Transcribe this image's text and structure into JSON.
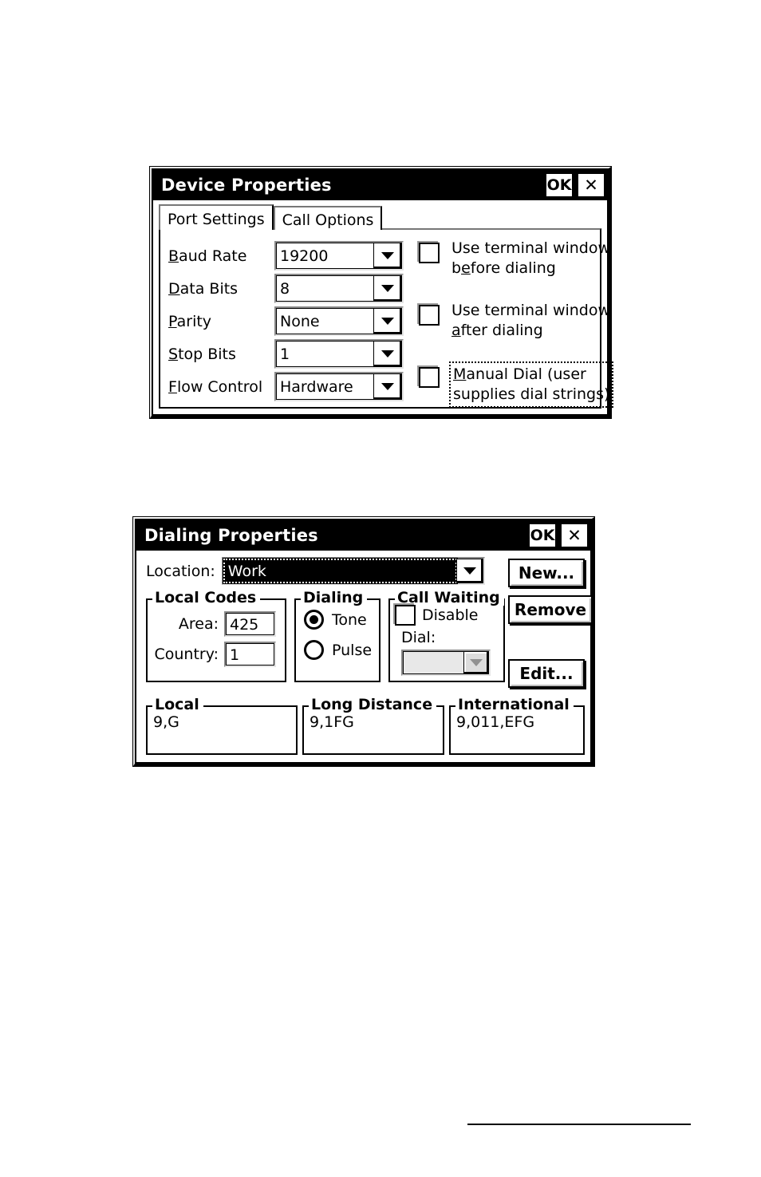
{
  "device_properties": {
    "title": "Device Properties",
    "ok_label": "OK",
    "close_label": "✕",
    "tabs": [
      {
        "label": "Port Settings",
        "active": true
      },
      {
        "label": "Call Options",
        "active": false
      }
    ],
    "fields": [
      {
        "label_pre": "",
        "accel": "B",
        "label_post": "aud Rate",
        "value": "19200"
      },
      {
        "label_pre": "",
        "accel": "D",
        "label_post": "ata Bits",
        "value": "8"
      },
      {
        "label_pre": "",
        "accel": "P",
        "label_post": "arity",
        "value": "None"
      },
      {
        "label_pre": "",
        "accel": "S",
        "label_post": "top Bits",
        "value": "1"
      },
      {
        "label_pre": "",
        "accel": "F",
        "label_post": "low Control",
        "value": "Hardware"
      }
    ],
    "checkboxes": [
      {
        "line1_pre": "Use terminal window",
        "line2_pre": "b",
        "accel": "e",
        "line2_post": "fore dialing",
        "checked": false,
        "focused": false
      },
      {
        "line1_pre": "Use terminal window",
        "line2_pre": "",
        "accel": "a",
        "line2_post": "fter dialing",
        "checked": false,
        "focused": false
      },
      {
        "line1_pre": "anual Dial (user",
        "line2_pre": "supplies dial strings)",
        "accel": "M",
        "line2_post": "",
        "checked": false,
        "focused": true
      }
    ]
  },
  "dialing_properties": {
    "title": "Dialing Properties",
    "ok_label": "OK",
    "close_label": "✕",
    "location": {
      "label": "Location:",
      "value": "Work"
    },
    "buttons": {
      "new": "New...",
      "remove": "Remove",
      "edit": "Edit..."
    },
    "local_codes": {
      "title": "Local Codes",
      "area_label": "Area:",
      "area_value": "425",
      "country_label": "Country:",
      "country_value": "1"
    },
    "dialing": {
      "title": "Dialing",
      "tone_label": "Tone",
      "pulse_label": "Pulse",
      "selected": "Tone"
    },
    "call_waiting": {
      "title": "Call Waiting",
      "disable_label": "Disable",
      "disable_checked": false,
      "dial_label": "Dial:",
      "dial_value": ""
    },
    "codes": [
      {
        "title": "Local",
        "value": "9,G"
      },
      {
        "title": "Long Distance",
        "value": "9,1FG"
      },
      {
        "title": "International",
        "value": "9,011,EFG"
      }
    ]
  }
}
